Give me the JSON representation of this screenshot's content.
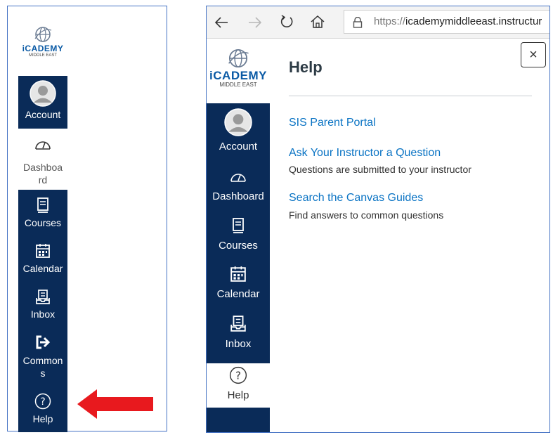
{
  "left_panel": {
    "logo": {
      "name": "iCADEMY",
      "sub": "MIDDLE EAST"
    },
    "nav": {
      "account": "Account",
      "dashboard_line1": "Dashboa",
      "dashboard_line2": "rd",
      "courses": "Courses",
      "calendar": "Calendar",
      "inbox": "Inbox",
      "commons_line1": "Common",
      "commons_line2": "s",
      "help": "Help"
    },
    "arrow_color": "#e8191e"
  },
  "browser": {
    "url": "https://icademymiddleeast.instructur",
    "url_scheme": "https://",
    "url_rest": "icademymiddleeast.instructur"
  },
  "right_panel": {
    "logo": {
      "name": "iCADEMY",
      "sub": "MIDDLE EAST"
    },
    "nav": {
      "account": "Account",
      "dashboard": "Dashboard",
      "courses": "Courses",
      "calendar": "Calendar",
      "inbox": "Inbox",
      "help": "Help"
    },
    "help_tray": {
      "title": "Help",
      "close_symbol": "×",
      "items": [
        {
          "link": "SIS Parent Portal",
          "desc": ""
        },
        {
          "link": "Ask Your Instructor a Question",
          "desc": "Questions are submitted to your instructor"
        },
        {
          "link": "Search the Canvas Guides",
          "desc": "Find answers to common questions"
        }
      ]
    }
  },
  "colors": {
    "navy": "#0a2b58",
    "link": "#0b74c4",
    "border": "#4472c4"
  }
}
